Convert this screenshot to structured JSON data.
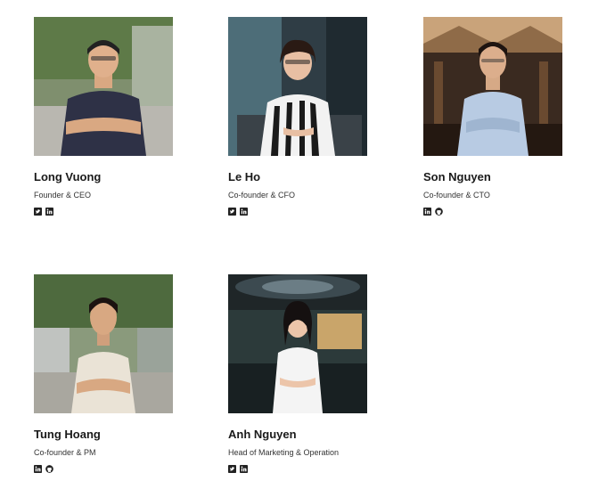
{
  "team": [
    {
      "name": "Long Vuong",
      "role": "Founder & CEO",
      "socials": [
        "twitter-icon",
        "linkedin-icon"
      ]
    },
    {
      "name": "Le Ho",
      "role": "Co-founder & CFO",
      "socials": [
        "twitter-icon",
        "linkedin-icon"
      ]
    },
    {
      "name": "Son Nguyen",
      "role": "Co-founder & CTO",
      "socials": [
        "linkedin-icon",
        "github-icon"
      ]
    },
    {
      "name": "Tung Hoang",
      "role": "Co-founder & PM",
      "socials": [
        "linkedin-icon",
        "github-icon"
      ]
    },
    {
      "name": "Anh Nguyen",
      "role": "Head of Marketing & Operation",
      "socials": [
        "twitter-icon",
        "linkedin-icon"
      ]
    }
  ]
}
